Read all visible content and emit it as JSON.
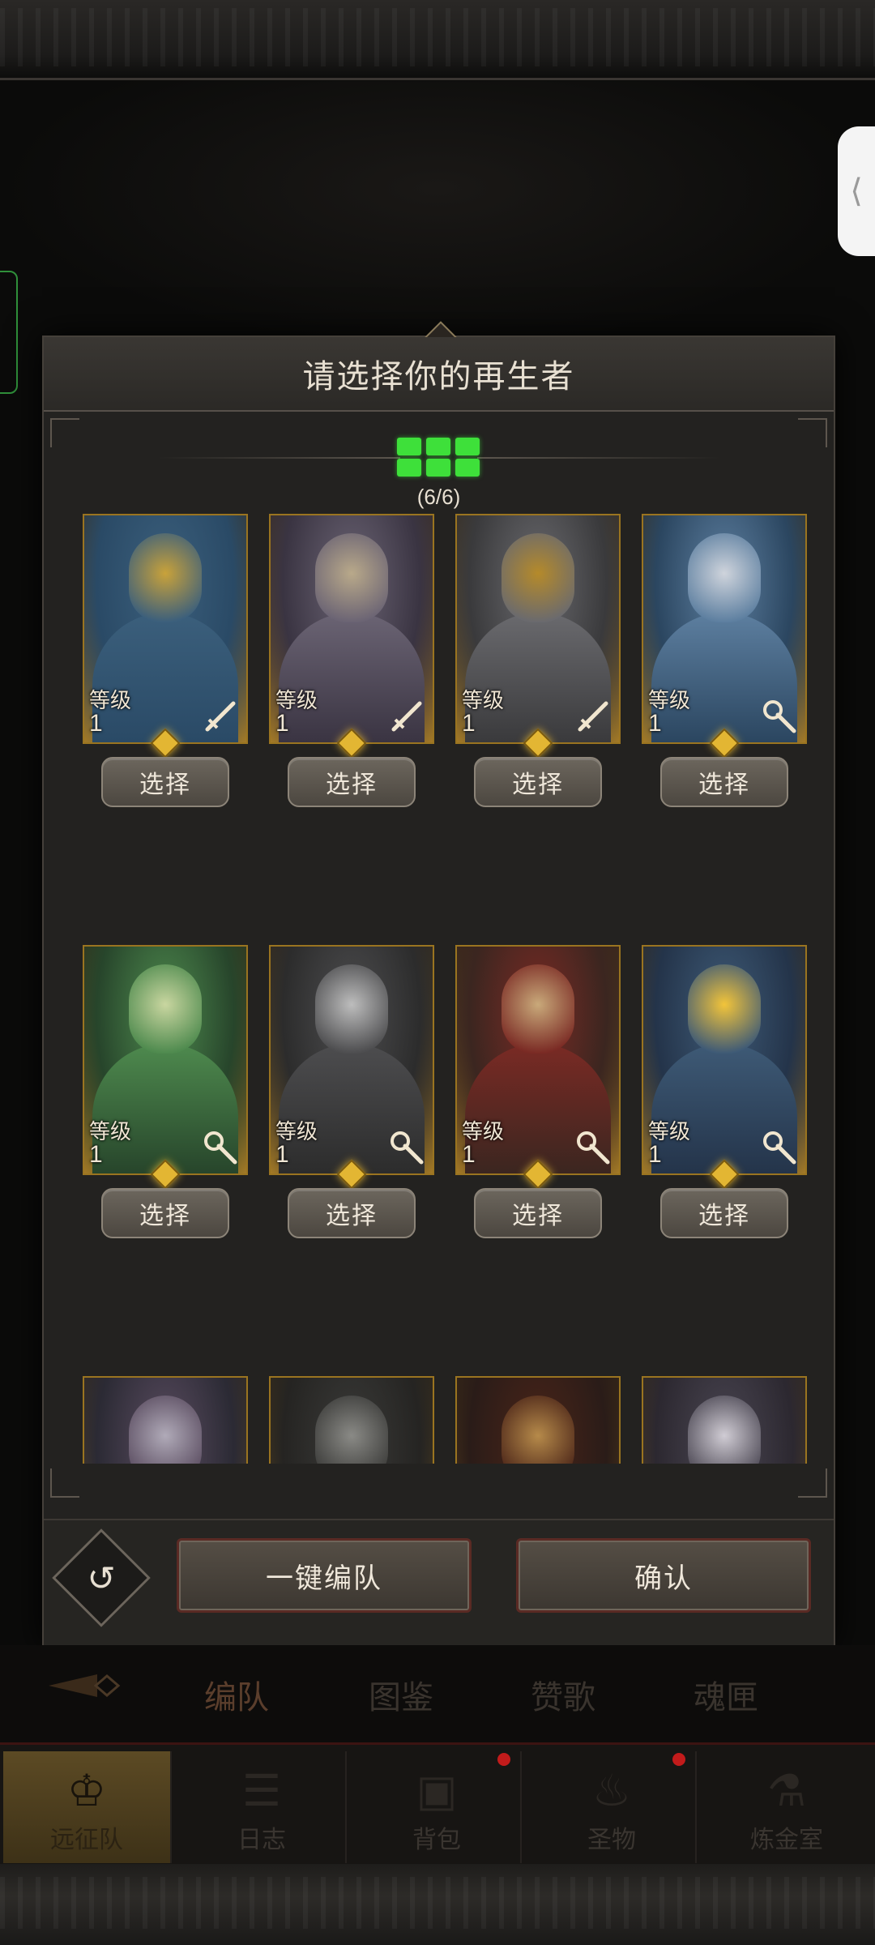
{
  "modal": {
    "title": "请选择你的再生者",
    "team_count": "(6/6)"
  },
  "heroes": [
    {
      "level_label": "等级",
      "level": "1",
      "class_icon": "sword-icon",
      "palette": [
        "#2a4a66",
        "#3b5f7c",
        "#c9a23a"
      ]
    },
    {
      "level_label": "等级",
      "level": "1",
      "class_icon": "sword-icon",
      "palette": [
        "#3a3442",
        "#6b6474",
        "#b9a98a"
      ]
    },
    {
      "level_label": "等级",
      "level": "1",
      "class_icon": "sword-icon",
      "palette": [
        "#3a3a3c",
        "#6a6a6e",
        "#b58a2a"
      ]
    },
    {
      "level_label": "等级",
      "level": "1",
      "class_icon": "staff-icon",
      "palette": [
        "#2b4660",
        "#5d7fa0",
        "#cfd4dc"
      ]
    },
    {
      "level_label": "等级",
      "level": "1",
      "class_icon": "staff-icon",
      "palette": [
        "#27452b",
        "#4e8a4e",
        "#c9d6a0"
      ]
    },
    {
      "level_label": "等级",
      "level": "1",
      "class_icon": "staff-icon",
      "palette": [
        "#2c2c2c",
        "#4d4d4f",
        "#bdbdbd"
      ]
    },
    {
      "level_label": "等级",
      "level": "1",
      "class_icon": "staff-icon",
      "palette": [
        "#3b2620",
        "#7a2a24",
        "#c9a97a"
      ]
    },
    {
      "level_label": "等级",
      "level": "1",
      "class_icon": "staff-icon",
      "palette": [
        "#24344a",
        "#3e5a76",
        "#f2c43a"
      ]
    },
    {
      "palette": [
        "#2b2a34",
        "#5a4c60",
        "#b0aab8"
      ]
    },
    {
      "palette": [
        "#252422",
        "#3a3a38",
        "#8a8a86"
      ]
    },
    {
      "palette": [
        "#2a1c18",
        "#4a2418",
        "#b68a4a"
      ]
    },
    {
      "palette": [
        "#2c2830",
        "#4a4652",
        "#d0ccd4"
      ]
    }
  ],
  "buttons": {
    "select_label": "选择",
    "auto_team": "一键编队",
    "confirm": "确认"
  },
  "subtabs": [
    "编队",
    "图鉴",
    "赞歌",
    "魂匣"
  ],
  "nav": [
    {
      "label": "远征队",
      "icon": "helmet-icon"
    },
    {
      "label": "日志",
      "icon": "scroll-icon"
    },
    {
      "label": "背包",
      "icon": "bag-icon"
    },
    {
      "label": "圣物",
      "icon": "relic-icon"
    },
    {
      "label": "炼金室",
      "icon": "alchemy-icon"
    }
  ]
}
